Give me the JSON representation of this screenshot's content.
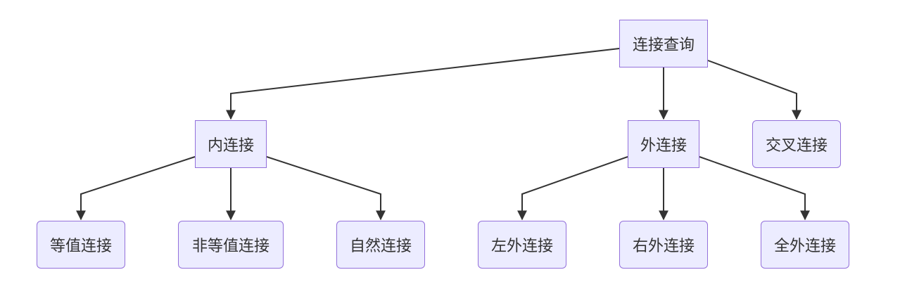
{
  "diagram": {
    "type": "flowchart-tree",
    "colors": {
      "node_fill": "#ececff",
      "node_border": "#9370db",
      "edge": "#333333",
      "text": "#333333"
    },
    "nodes": {
      "root": "连接查询",
      "inner": "内连接",
      "outer": "外连接",
      "cross": "交叉连接",
      "equi": "等值连接",
      "nonequi": "非等值连接",
      "natural": "自然连接",
      "left": "左外连接",
      "right": "右外连接",
      "full": "全外连接"
    },
    "edges": [
      [
        "root",
        "inner"
      ],
      [
        "root",
        "outer"
      ],
      [
        "root",
        "cross"
      ],
      [
        "inner",
        "equi"
      ],
      [
        "inner",
        "nonequi"
      ],
      [
        "inner",
        "natural"
      ],
      [
        "outer",
        "left"
      ],
      [
        "outer",
        "right"
      ],
      [
        "outer",
        "full"
      ]
    ]
  }
}
